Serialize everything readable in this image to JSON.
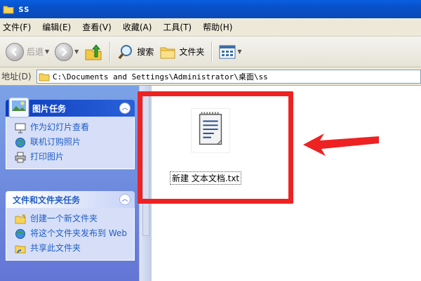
{
  "window": {
    "title": "ss"
  },
  "menu": {
    "items": [
      "文件(F)",
      "编辑(E)",
      "查看(V)",
      "收藏(A)",
      "工具(T)",
      "帮助(H)"
    ]
  },
  "toolbar": {
    "back_label": "后退",
    "search_label": "搜索",
    "folders_label": "文件夹"
  },
  "address": {
    "label": "地址(D)",
    "path": "C:\\Documents and Settings\\Administrator\\桌面\\ss"
  },
  "picture_tasks": {
    "title": "图片任务",
    "items": [
      "作为幻灯片查看",
      "联机订购照片",
      "打印图片"
    ]
  },
  "file_folder_tasks": {
    "title": "文件和文件夹任务",
    "items": [
      "创建一个新文件夹",
      "将这个文件夹发布到 Web",
      "共享此文件夹"
    ]
  },
  "files": [
    {
      "name": "新建 文本文档.txt"
    }
  ],
  "colors": {
    "annotation_red": "#ee2222",
    "titlebar_blue": "#0a5fe0",
    "task_link": "#215dc6"
  }
}
